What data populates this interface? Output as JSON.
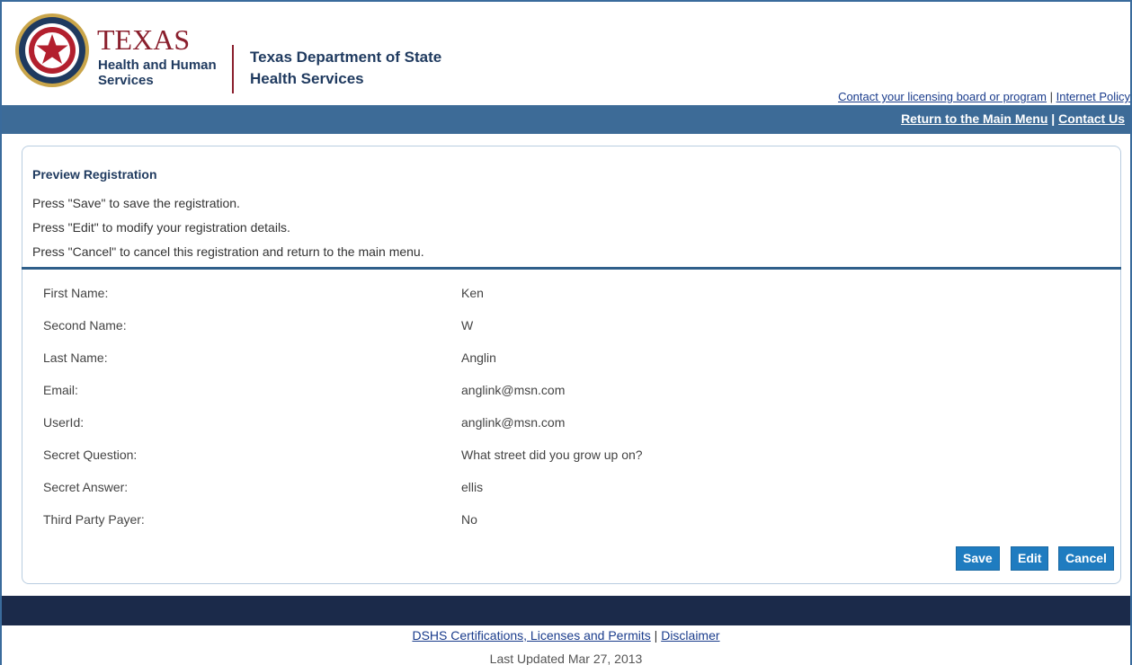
{
  "header": {
    "logo_texas": "TEXAS",
    "logo_hhs_line1": "Health and Human",
    "logo_hhs_line2": "Services",
    "agency_line1": "Texas Department of State",
    "agency_line2": "Health Services",
    "top_links": {
      "licensing": "Contact your licensing board or program",
      "separator": " | ",
      "internet_policy": "Internet Policy"
    },
    "nav_links": {
      "main_menu": "Return to the Main Menu",
      "separator": " | ",
      "contact_us": "Contact Us"
    }
  },
  "panel": {
    "title": "Preview Registration",
    "instructions": [
      "Press \"Save\" to save the registration.",
      "Press \"Edit\" to modify your registration details.",
      "Press \"Cancel\" to cancel this registration and return to the main menu."
    ],
    "fields": [
      {
        "label": "First Name:",
        "value": "Ken"
      },
      {
        "label": "Second Name:",
        "value": "W"
      },
      {
        "label": "Last Name:",
        "value": "Anglin"
      },
      {
        "label": "Email:",
        "value": "anglink@msn.com"
      },
      {
        "label": "UserId:",
        "value": "anglink@msn.com"
      },
      {
        "label": "Secret Question:",
        "value": "What street did you grow up on?"
      },
      {
        "label": "Secret Answer:",
        "value": "ellis"
      },
      {
        "label": "Third Party Payer:",
        "value": "No"
      }
    ],
    "buttons": {
      "save": "Save",
      "edit": "Edit",
      "cancel": "Cancel"
    }
  },
  "footer": {
    "certifications": "DSHS Certifications, Licenses and Permits",
    "separator": " | ",
    "disclaimer": "Disclaimer",
    "last_updated": "Last Updated Mar 27, 2013"
  },
  "colors": {
    "nav_bar": "#3d6b97",
    "footer_bar": "#1b2a4a",
    "button": "#1f7cc0",
    "texas_red": "#8a1f2d",
    "navy": "#1f3a5f"
  },
  "icons": {
    "seal": "texas-hhs-seal-icon"
  }
}
